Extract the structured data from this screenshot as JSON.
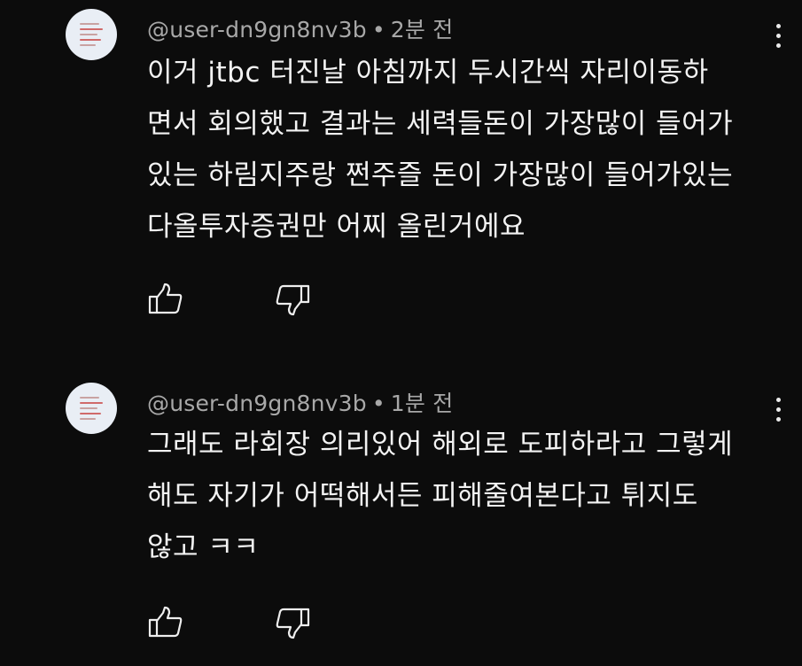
{
  "comments": [
    {
      "author": "@user-dn9gn8nv3b",
      "separator": "•",
      "time": "2분 전",
      "lines": [
        "이거 jtbc 터진날 아침까지 두시간씩 자리이동하",
        "면서 회의했고 결과는 세력들돈이 가장많이 들어가",
        "있는 하림지주랑 쩐주즐 돈이 가장많이 들어가있는",
        "다올투자증권만 어찌 올린거에요"
      ],
      "avatar_icon": "default-avatar-icon",
      "like_icon": "thumbs-up-icon",
      "dislike_icon": "thumbs-down-icon",
      "menu_icon": "more-vertical-icon"
    },
    {
      "author": "@user-dn9gn8nv3b",
      "separator": "•",
      "time": "1분 전",
      "lines": [
        "그래도 라회장 의리있어 해외로 도피하라고 그렇게",
        "해도 자기가 어떡해서든 피해줄여본다고 튀지도",
        "않고 ㅋㅋ"
      ],
      "avatar_icon": "default-avatar-icon",
      "like_icon": "thumbs-up-icon",
      "dislike_icon": "thumbs-down-icon",
      "menu_icon": "more-vertical-icon"
    }
  ],
  "colors": {
    "background": "#0c0c0c",
    "text": "#f3f3f3",
    "meta": "#a8a8a8",
    "avatar_bg": "#e9eef5"
  }
}
